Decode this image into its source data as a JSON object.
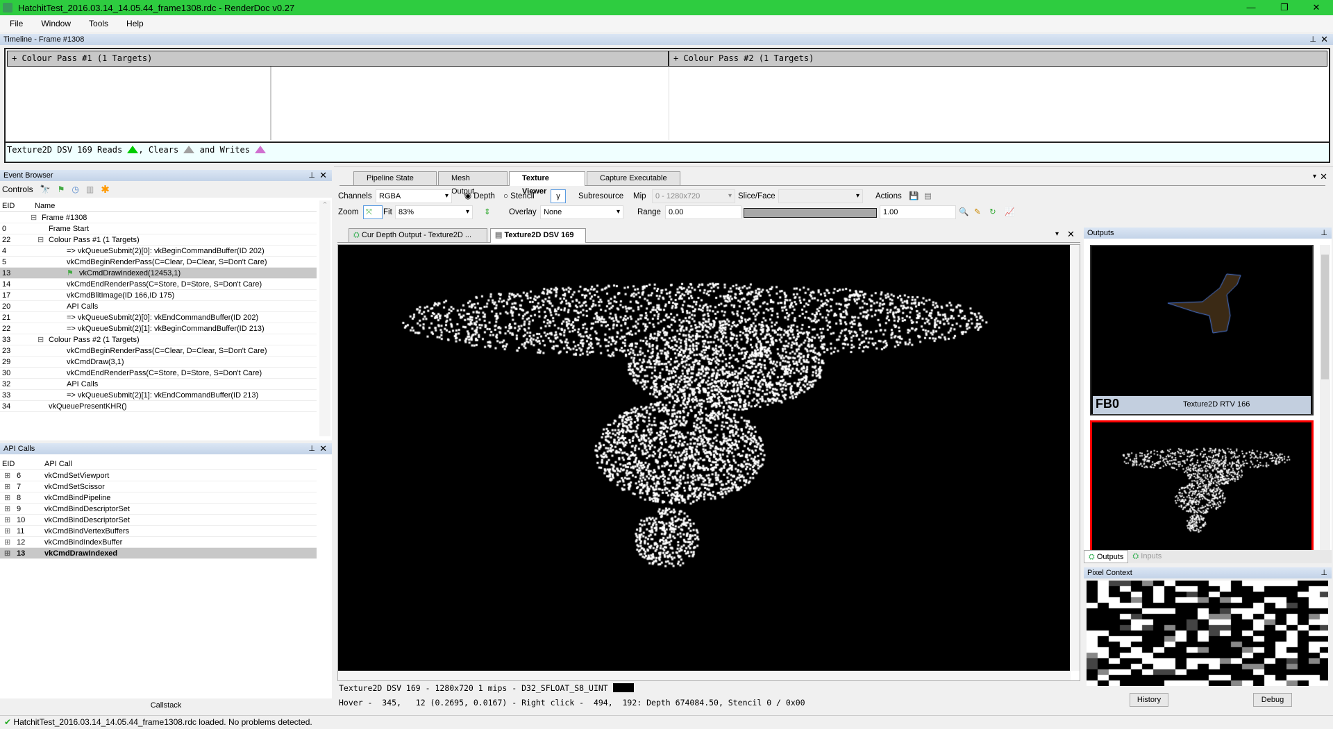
{
  "window": {
    "title": "HatchitTest_2016.03.14_14.05.44_frame1308.rdc - RenderDoc v0.27",
    "min": "—",
    "max": "❐",
    "close": "✕"
  },
  "menu": [
    "File",
    "Window",
    "Tools",
    "Help"
  ],
  "timeline": {
    "title": "Timeline - Frame #1308",
    "passes": [
      "+ Colour Pass #1 (1 Targets)",
      "+ Colour Pass #2 (1 Targets)"
    ],
    "legend": {
      "prefix": "Texture2D DSV 169 Reads",
      "clears": ", Clears",
      "writes": "and Writes",
      "colors": {
        "reads": "#00cc00",
        "clears": "#a0a0a0",
        "writes": "#d070d0"
      }
    }
  },
  "event_browser": {
    "title": "Event Browser",
    "controls_label": "Controls",
    "columns": [
      "EID",
      "Name"
    ],
    "rows": [
      {
        "eid": "",
        "name": "Frame #1308",
        "depth": 0,
        "expander": "⊟"
      },
      {
        "eid": "0",
        "name": "Frame Start",
        "depth": 1
      },
      {
        "eid": "22",
        "name": "Colour Pass #1 (1 Targets)",
        "depth": 1,
        "expander": "⊟"
      },
      {
        "eid": "4",
        "name": "=> vkQueueSubmit(2)[0]: vkBeginCommandBuffer(ID 202)",
        "depth": 2
      },
      {
        "eid": "5",
        "name": "vkCmdBeginRenderPass(C=Clear, D=Clear, S=Don't Care)",
        "depth": 2
      },
      {
        "eid": "13",
        "name": "vkCmdDrawIndexed(12453,1)",
        "depth": 2,
        "selected": true,
        "flag": true
      },
      {
        "eid": "14",
        "name": "vkCmdEndRenderPass(C=Store, D=Store, S=Don't Care)",
        "depth": 2
      },
      {
        "eid": "17",
        "name": "vkCmdBlitImage(ID 166,ID 175)",
        "depth": 2
      },
      {
        "eid": "20",
        "name": "API Calls",
        "depth": 2
      },
      {
        "eid": "21",
        "name": "=> vkQueueSubmit(2)[0]: vkEndCommandBuffer(ID 202)",
        "depth": 2
      },
      {
        "eid": "22",
        "name": "=> vkQueueSubmit(2)[1]: vkBeginCommandBuffer(ID 213)",
        "depth": 2
      },
      {
        "eid": "33",
        "name": "Colour Pass #2 (1 Targets)",
        "depth": 1,
        "expander": "⊟"
      },
      {
        "eid": "23",
        "name": "vkCmdBeginRenderPass(C=Clear, D=Clear, S=Don't Care)",
        "depth": 2
      },
      {
        "eid": "29",
        "name": "vkCmdDraw(3,1)",
        "depth": 2
      },
      {
        "eid": "30",
        "name": "vkCmdEndRenderPass(C=Store, D=Store, S=Don't Care)",
        "depth": 2
      },
      {
        "eid": "32",
        "name": "API Calls",
        "depth": 2
      },
      {
        "eid": "33",
        "name": "=> vkQueueSubmit(2)[1]: vkEndCommandBuffer(ID 213)",
        "depth": 2
      },
      {
        "eid": "34",
        "name": "vkQueuePresentKHR()",
        "depth": 1
      }
    ]
  },
  "api_calls": {
    "title": "API Calls",
    "columns": [
      "EID",
      "API Call"
    ],
    "rows": [
      {
        "eid": "6",
        "name": "vkCmdSetViewport"
      },
      {
        "eid": "7",
        "name": "vkCmdSetScissor"
      },
      {
        "eid": "8",
        "name": "vkCmdBindPipeline"
      },
      {
        "eid": "9",
        "name": "vkCmdBindDescriptorSet"
      },
      {
        "eid": "10",
        "name": "vkCmdBindDescriptorSet"
      },
      {
        "eid": "11",
        "name": "vkCmdBindVertexBuffers"
      },
      {
        "eid": "12",
        "name": "vkCmdBindIndexBuffer"
      },
      {
        "eid": "13",
        "name": "vkCmdDrawIndexed",
        "selected": true
      }
    ],
    "callstack": "Callstack"
  },
  "main_tabs": [
    {
      "label": "Pipeline State"
    },
    {
      "label": "Mesh Output"
    },
    {
      "label": "Texture Viewer",
      "active": true
    },
    {
      "label": "Capture Executable"
    }
  ],
  "texture_viewer": {
    "channels_label": "Channels",
    "channels": "RGBA",
    "depth_label": "Depth",
    "depth_checked": true,
    "stencil_label": "Stencil",
    "gamma": "γ",
    "subresource_label": "Subresource",
    "mip_label": "Mip",
    "mip": "0 - 1280x720",
    "slice_label": "Slice/Face",
    "slice": "",
    "actions_label": "Actions",
    "zoom_label": "Zoom",
    "fit_label": "Fit",
    "zoom": "83%",
    "overlay_label": "Overlay",
    "overlay": "None",
    "range_label": "Range",
    "range_min": "0.00",
    "range_max": "1.00",
    "sub_tabs": [
      {
        "label": "Cur Depth Output - Texture2D ..."
      },
      {
        "label": "Texture2D DSV 169",
        "active": true
      }
    ],
    "info": "Texture2D DSV 169 - 1280x720 1 mips - D32_SFLOAT_S8_UINT",
    "hover": "Hover -  345,   12 (0.2695, 0.0167) - Right click -  494,  192: Depth 674084.50, Stencil 0 / 0x00"
  },
  "outputs": {
    "title": "Outputs",
    "thumbs": [
      {
        "slot": "FB0",
        "name": "Texture2D RTV 166"
      }
    ],
    "tabs": [
      "Outputs",
      "Inputs"
    ]
  },
  "pixel_context": {
    "title": "Pixel Context",
    "history": "History",
    "debug": "Debug"
  },
  "status": "HatchitTest_2016.03.14_14.05.44_frame1308.rdc loaded. No problems detected."
}
